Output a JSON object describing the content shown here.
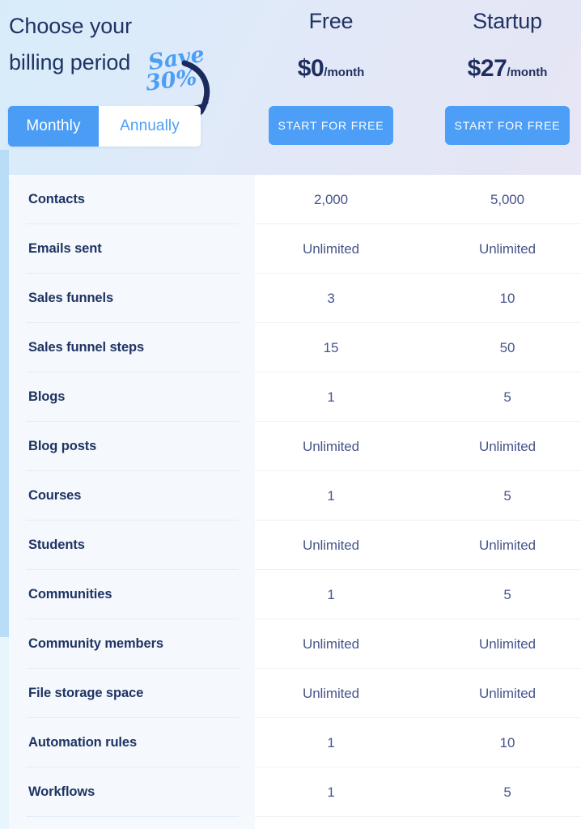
{
  "header": {
    "headline_line1": "Choose your",
    "headline_line2": "billing period",
    "save_badge": {
      "line1": "Save",
      "line2": "30%",
      "arrow_icon": "curved-arrow-down-left-icon",
      "color": "#4d9ef6",
      "arrow_color": "#1b2a5c"
    },
    "billing_toggle": {
      "monthly_label": "Monthly",
      "annually_label": "Annually",
      "selected": "Monthly",
      "active_bg": "#4a9cf5",
      "active_text": "#ffffff",
      "inactive_bg": "#ffffff",
      "inactive_text": "#4d9ef6"
    },
    "background_gradient_from": "#d7ecfa",
    "background_gradient_to": "#e6e6f4",
    "heading_color": "#1f3364"
  },
  "plans": [
    {
      "name": "Free",
      "price": "$0",
      "period": "/month",
      "cta_label": "START FOR FREE",
      "cta_color": "#4d9ef6"
    },
    {
      "name": "Startup",
      "price": "$27",
      "period": "/month",
      "cta_label": "START FOR FREE",
      "cta_color": "#4d9ef6"
    }
  ],
  "comparison_table": {
    "label_column_bg": "#f5f9fd",
    "value_column_bg": "#ffffff",
    "label_color": "#1f3364",
    "value_color": "#46558c",
    "rows": [
      {
        "label": "Contacts",
        "values": [
          "2,000",
          "5,000"
        ]
      },
      {
        "label": "Emails sent",
        "values": [
          "Unlimited",
          "Unlimited"
        ]
      },
      {
        "label": "Sales funnels",
        "values": [
          "3",
          "10"
        ]
      },
      {
        "label": "Sales funnel steps",
        "values": [
          "15",
          "50"
        ]
      },
      {
        "label": "Blogs",
        "values": [
          "1",
          "5"
        ]
      },
      {
        "label": "Blog posts",
        "values": [
          "Unlimited",
          "Unlimited"
        ]
      },
      {
        "label": "Courses",
        "values": [
          "1",
          "5"
        ]
      },
      {
        "label": "Students",
        "values": [
          "Unlimited",
          "Unlimited"
        ]
      },
      {
        "label": "Communities",
        "values": [
          "1",
          "5"
        ]
      },
      {
        "label": "Community members",
        "values": [
          "Unlimited",
          "Unlimited"
        ]
      },
      {
        "label": "File storage space",
        "values": [
          "Unlimited",
          "Unlimited"
        ]
      },
      {
        "label": "Automation rules",
        "values": [
          "1",
          "10"
        ]
      },
      {
        "label": "Workflows",
        "values": [
          "1",
          "5"
        ]
      }
    ]
  },
  "scrollbar": {
    "track_color": "#e9f5fd",
    "thumb_color": "#b9dcf7"
  }
}
